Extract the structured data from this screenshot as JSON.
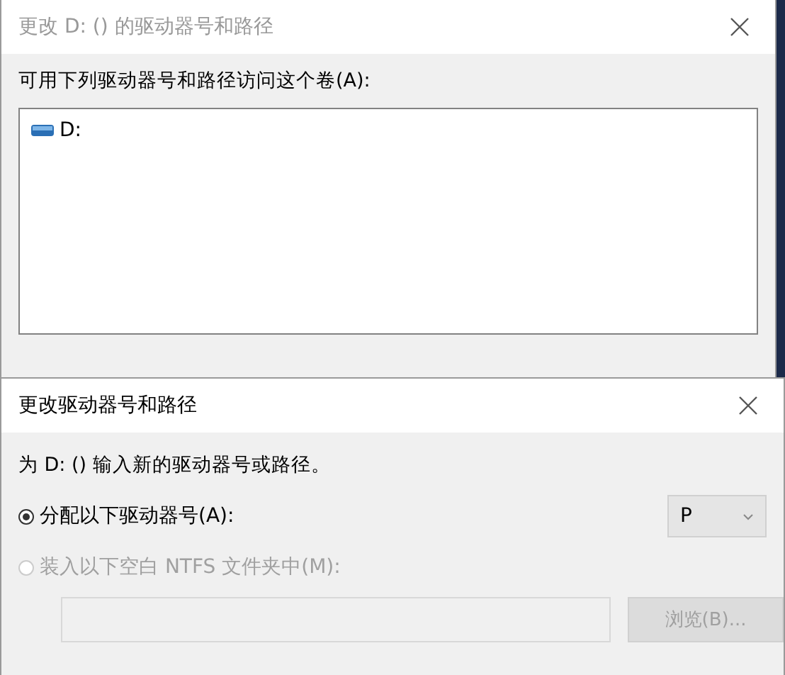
{
  "back_window": {
    "title": "更改 D: () 的驱动器号和路径",
    "active": false,
    "list_label": "可用下列驱动器号和路径访问这个卷(A):",
    "list_items": [
      {
        "label": "D:",
        "selected": false
      }
    ]
  },
  "front_window": {
    "title": "更改驱动器号和路径",
    "active": true,
    "prompt": "为 D: () 输入新的驱动器号或路径。",
    "options": [
      {
        "label": "分配以下驱动器号(A):",
        "selected": true,
        "disabled": false
      },
      {
        "label": "装入以下空白 NTFS 文件夹中(M):",
        "selected": false,
        "disabled": true
      }
    ],
    "letter_dropdown": {
      "value": "P"
    },
    "folder_field": {
      "disabled": true
    },
    "browse_button": {
      "label": "浏览(B)...",
      "disabled": true
    }
  }
}
